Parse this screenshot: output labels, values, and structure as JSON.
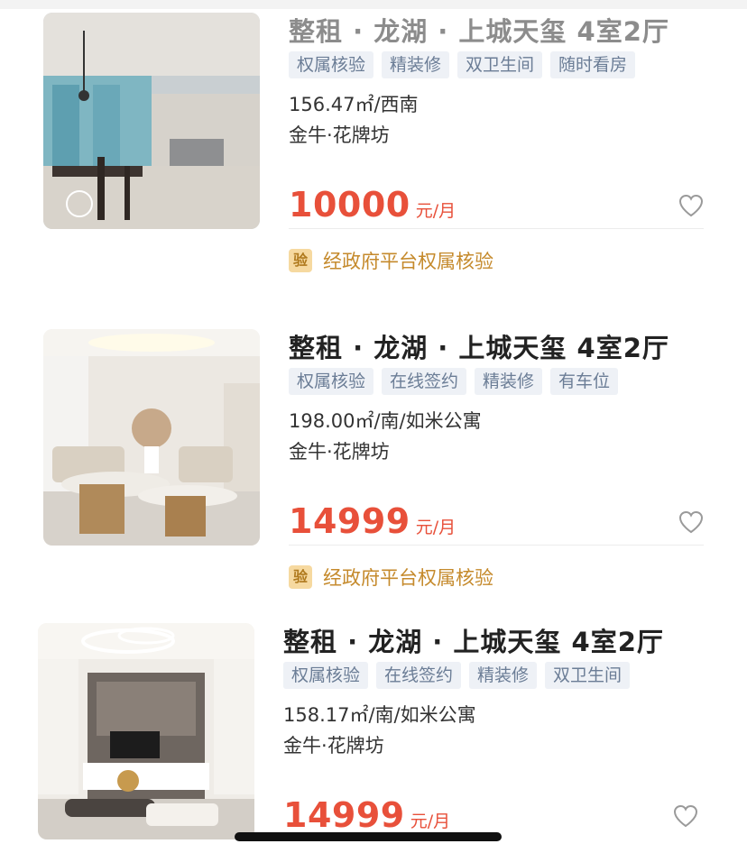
{
  "listings": [
    {
      "title": "整租 · 龙湖 · 上城天玺 4室2厅",
      "tags": [
        "权属核验",
        "精装修",
        "双卫生间",
        "随时看房"
      ],
      "info": "156.47㎡/西南",
      "location": "金牛·花牌坊",
      "price": "10000",
      "unit": "元/月",
      "verify_badge": "验",
      "verify_text": "经政府平台权属核验"
    },
    {
      "title": "整租 · 龙湖 · 上城天玺 4室2厅",
      "tags": [
        "权属核验",
        "在线签约",
        "精装修",
        "有车位"
      ],
      "info": "198.00㎡/南/如米公寓",
      "location": "金牛·花牌坊",
      "price": "14999",
      "unit": "元/月",
      "verify_badge": "验",
      "verify_text": "经政府平台权属核验"
    },
    {
      "title": "整租 · 龙湖 · 上城天玺 4室2厅",
      "tags": [
        "权属核验",
        "在线签约",
        "精装修",
        "双卫生间"
      ],
      "info": "158.17㎡/南/如米公寓",
      "location": "金牛·花牌坊",
      "price": "14999",
      "unit": "元/月"
    }
  ],
  "colors": {
    "price": "#e8503a",
    "tag_bg": "#eef1f6",
    "tag_text": "#6b7d96",
    "verify_text": "#c58a2c"
  },
  "icons": {
    "favorite": "heart-outline-icon"
  }
}
